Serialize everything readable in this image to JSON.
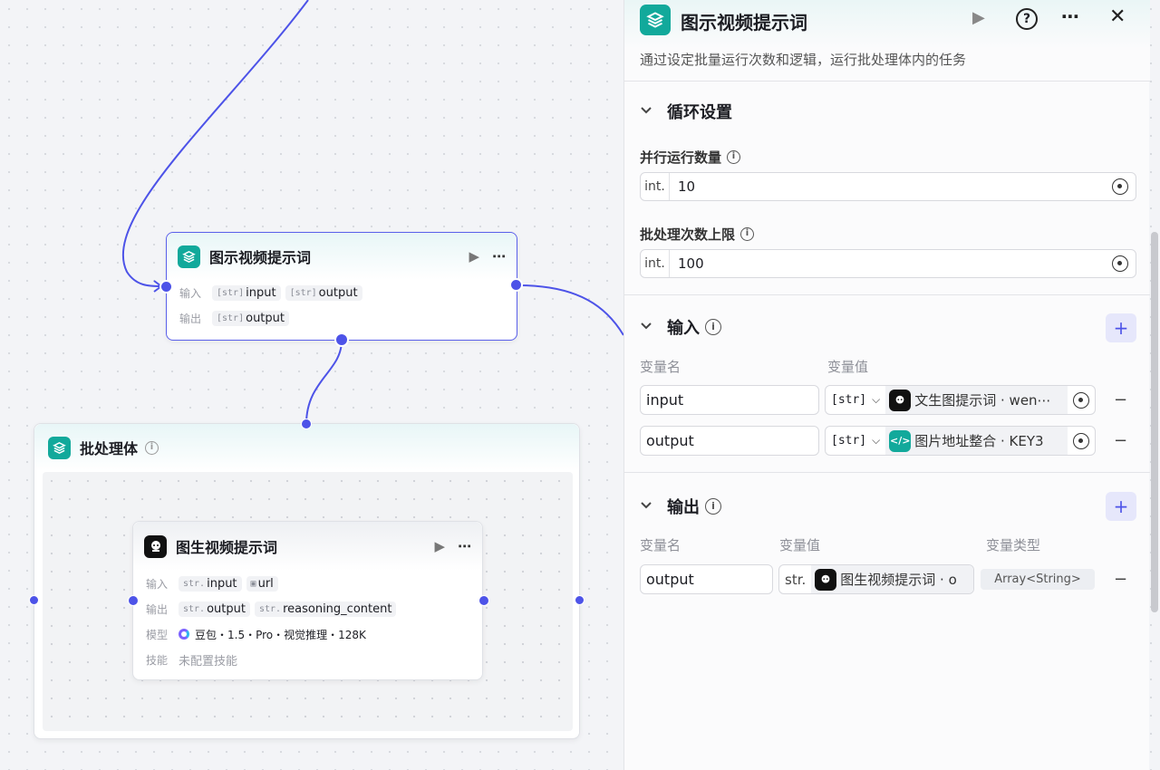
{
  "canvas": {
    "top_node": {
      "title": "图示视频提示词",
      "input_label": "输入",
      "output_label": "输出",
      "inputs": [
        {
          "type": "[str]",
          "name": "input"
        },
        {
          "type": "[str]",
          "name": "output"
        }
      ],
      "outputs": [
        {
          "type": "[str]",
          "name": "output"
        }
      ]
    },
    "batch_node": {
      "title": "批处理体",
      "inner": {
        "title": "图生视频提示词",
        "input_label": "输入",
        "output_label": "输出",
        "model_label": "模型",
        "skill_label": "技能",
        "inputs": [
          {
            "type": "str.",
            "name": "input"
          },
          {
            "type": "img",
            "name": "url"
          }
        ],
        "outputs": [
          {
            "type": "str.",
            "name": "output"
          },
          {
            "type": "str.",
            "name": "reasoning_content"
          }
        ],
        "model": "豆包・1.5・Pro・视觉推理・128K",
        "skill": "未配置技能"
      }
    }
  },
  "panel": {
    "title": "图示视频提示词",
    "description": "通过设定批量运行次数和逻辑，运行批处理体内的任务",
    "loop_section": {
      "title": "循环设置",
      "parallel_label": "并行运行数量",
      "parallel_type": "int.",
      "parallel_value": "10",
      "limit_label": "批处理次数上限",
      "limit_type": "int.",
      "limit_value": "100"
    },
    "input_section": {
      "title": "输入",
      "col_name": "变量名",
      "col_value": "变量值",
      "rows": [
        {
          "name": "input",
          "type": "[str]",
          "source": "文生图提示词 · wen⋯",
          "icon": "bot-icon"
        },
        {
          "name": "output",
          "type": "[str]",
          "source": "图片地址整合 · KEY3",
          "icon": "code-icon"
        }
      ]
    },
    "output_section": {
      "title": "输出",
      "col_name": "变量名",
      "col_value": "变量值",
      "col_type": "变量类型",
      "rows": [
        {
          "name": "output",
          "type": "str.",
          "source": "图生视频提示词 · o",
          "var_type": "Array<String>"
        }
      ]
    }
  },
  "colors": {
    "accent": "#4d53e8",
    "teal": "#12a99b"
  }
}
